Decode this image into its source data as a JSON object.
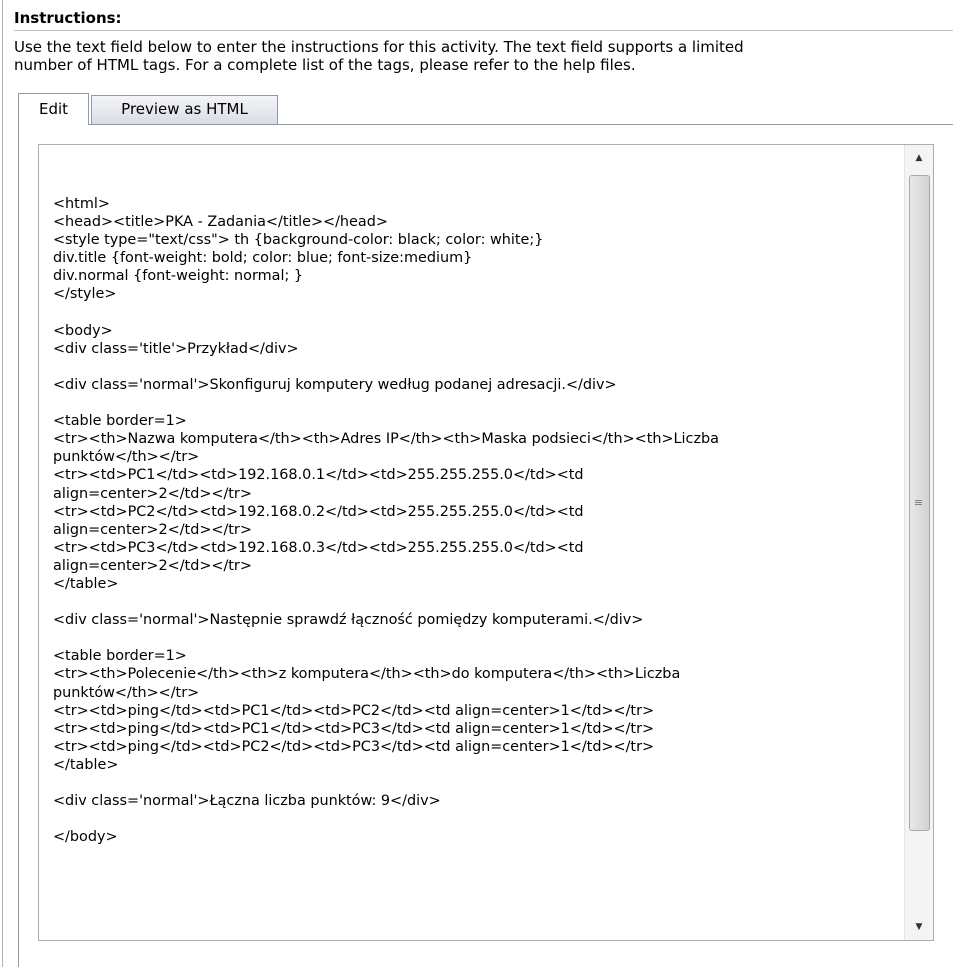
{
  "instructions": {
    "heading": "Instructions:",
    "description": "Use the text field below to enter the instructions for this activity. The text field supports a limited\nnumber of HTML tags. For a complete list of the tags, please refer to the help files."
  },
  "tabs": {
    "edit_label": "Edit",
    "preview_label": "Preview as HTML"
  },
  "editor": {
    "content": "<html>\n<head><title>PKA - Zadania</title></head>\n<style type=\"text/css\"> th {background-color: black; color: white;}\ndiv.title {font-weight: bold; color: blue; font-size:medium}\ndiv.normal {font-weight: normal; }\n</style>\n\n<body>\n<div class='title'>Przykład</div>\n\n<div class='normal'>Skonfiguruj komputery według podanej adresacji.</div>\n\n<table border=1>\n<tr><th>Nazwa komputera</th><th>Adres IP</th><th>Maska podsieci</th><th>Liczba\npunktów</th></tr>\n<tr><td>PC1</td><td>192.168.0.1</td><td>255.255.255.0</td><td\nalign=center>2</td></tr>\n<tr><td>PC2</td><td>192.168.0.2</td><td>255.255.255.0</td><td\nalign=center>2</td></tr>\n<tr><td>PC3</td><td>192.168.0.3</td><td>255.255.255.0</td><td\nalign=center>2</td></tr>\n</table>\n\n<div class='normal'>Następnie sprawdź łączność pomiędzy komputerami.</div>\n\n<table border=1>\n<tr><th>Polecenie</th><th>z komputera</th><th>do komputera</th><th>Liczba\npunktów</th></tr>\n<tr><td>ping</td><td>PC1</td><td>PC2</td><td align=center>1</td></tr>\n<tr><td>ping</td><td>PC1</td><td>PC3</td><td align=center>1</td></tr>\n<tr><td>ping</td><td>PC2</td><td>PC3</td><td align=center>1</td></tr>\n</table>\n\n<div class='normal'>Łączna liczba punktów: 9</div>\n\n</body>"
  },
  "icons": {
    "scroll_up": "scroll-up-arrow-icon",
    "scroll_down": "scroll-down-arrow-icon",
    "grip": "scroll-grip-icon"
  }
}
